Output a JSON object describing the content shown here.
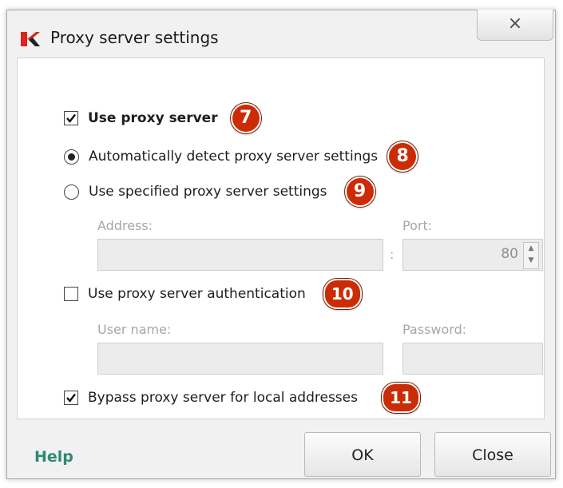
{
  "window": {
    "title": "Proxy server settings",
    "close_glyph": "×"
  },
  "options": {
    "use_proxy": {
      "label": "Use proxy server",
      "checked": true,
      "badge": "7"
    },
    "auto_detect": {
      "label": "Automatically detect proxy server settings",
      "selected": true,
      "badge": "8"
    },
    "specified": {
      "label": "Use specified proxy server settings",
      "selected": false,
      "badge": "9"
    },
    "address_label": "Address:",
    "port_label": "Port:",
    "port_value": "80",
    "port_separator": ":",
    "auth": {
      "label": "Use proxy server authentication",
      "checked": false,
      "badge": "10"
    },
    "username_label": "User name:",
    "password_label": "Password:",
    "bypass": {
      "label": "Bypass proxy server for local addresses",
      "checked": true,
      "badge": "11"
    }
  },
  "footer": {
    "help": "Help",
    "ok": "OK",
    "close": "Close"
  },
  "colors": {
    "badge": "#cc2c05",
    "help_link": "#2e8a72",
    "disabled_text": "#a7a7a7"
  },
  "icons": {
    "logo": "kaspersky-k-icon",
    "spin_up": "▲",
    "spin_down": "▼"
  }
}
